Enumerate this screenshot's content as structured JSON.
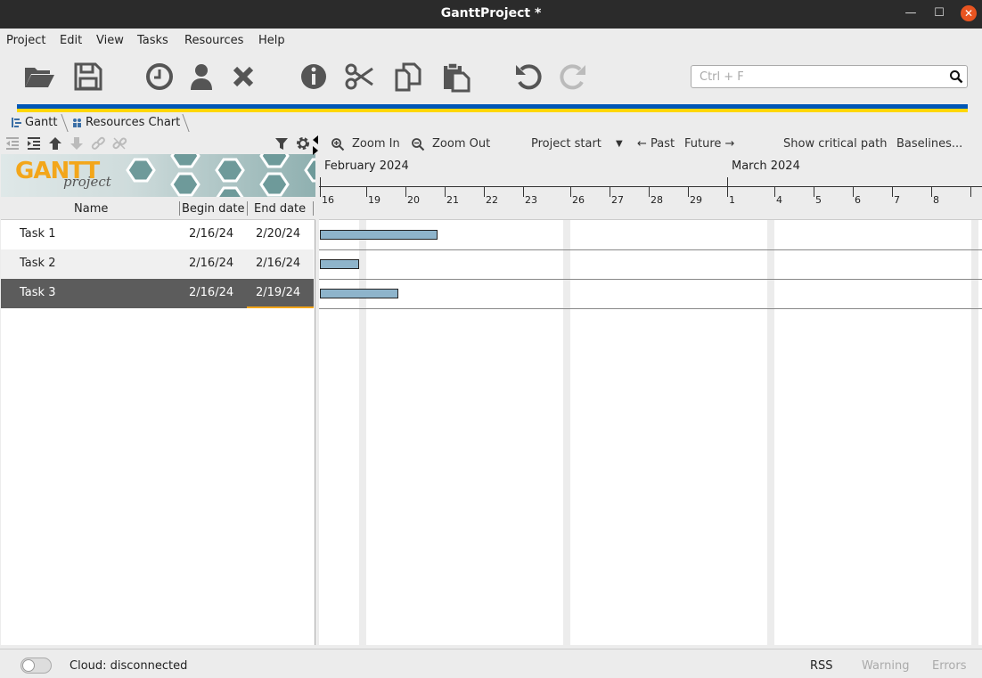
{
  "window": {
    "title": "GanttProject *"
  },
  "menu": [
    "Project",
    "Edit",
    "View",
    "Tasks",
    "Resources",
    "Help"
  ],
  "search": {
    "placeholder": "Ctrl + F"
  },
  "tabs": [
    "Gantt",
    "Resources Chart"
  ],
  "logo": {
    "line1": "GANTT",
    "line2": "project"
  },
  "grid": {
    "headers": {
      "name": "Name",
      "begin": "Begin date",
      "end": "End date"
    },
    "rows": [
      {
        "name": "Task 1",
        "begin": "2/16/24",
        "end": "2/20/24"
      },
      {
        "name": "Task 2",
        "begin": "2/16/24",
        "end": "2/16/24"
      },
      {
        "name": "Task 3",
        "begin": "2/16/24",
        "end": "2/19/24"
      }
    ]
  },
  "chart_toolbar": {
    "zoom_in": "Zoom In",
    "zoom_out": "Zoom Out",
    "project_start": "Project start",
    "past": "← Past",
    "future": "Future →",
    "critical": "Show critical path",
    "baselines": "Baselines..."
  },
  "timeline": {
    "months": [
      "February 2024",
      "March 2024"
    ],
    "days": [
      "16",
      "19",
      "20",
      "21",
      "22",
      "23",
      "26",
      "27",
      "28",
      "29",
      "1",
      "4",
      "5",
      "6",
      "7",
      "8"
    ]
  },
  "chart_data": {
    "type": "gantt",
    "tasks": [
      {
        "name": "Task 1",
        "start": "2024-02-16",
        "end": "2024-02-20"
      },
      {
        "name": "Task 2",
        "start": "2024-02-16",
        "end": "2024-02-16"
      },
      {
        "name": "Task 3",
        "start": "2024-02-16",
        "end": "2024-02-19"
      }
    ]
  },
  "status": {
    "cloud": "Cloud: disconnected",
    "rss": "RSS",
    "warning": "Warning",
    "errors": "Errors"
  },
  "colors": {
    "accent": "#f3a61a",
    "bar": "#8eb4cb",
    "selected_row": "#5c5c5c",
    "close": "#e95420"
  }
}
